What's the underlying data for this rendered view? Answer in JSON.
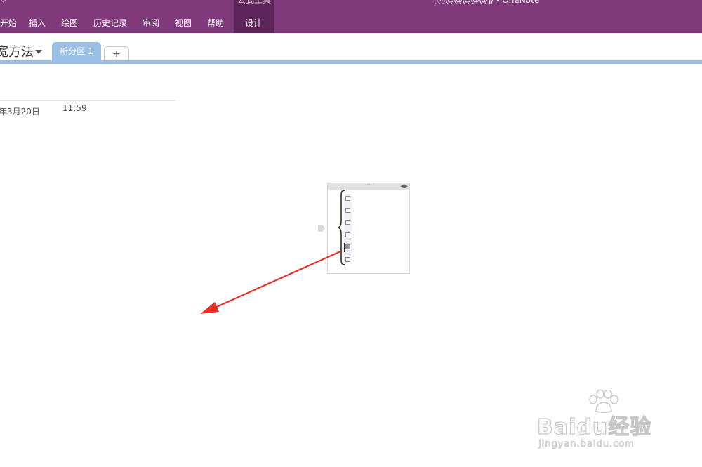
{
  "window": {
    "title": "[ⓐ@@@@@]/ - OneNote",
    "corner_glyph": "◇",
    "context_group_title": "公式工具"
  },
  "ribbon": {
    "tabs": [
      {
        "label": "开始"
      },
      {
        "label": "插入"
      },
      {
        "label": "绘图"
      },
      {
        "label": "历史记录"
      },
      {
        "label": "审阅"
      },
      {
        "label": "视图"
      },
      {
        "label": "帮助"
      },
      {
        "label": "设计",
        "active": true
      }
    ]
  },
  "notebook": {
    "name": "宽方法",
    "sections": [
      {
        "label": "新分区 1",
        "active": true
      }
    ],
    "add_section_label": "+"
  },
  "page": {
    "date": "年3月20日",
    "time": "11:59"
  },
  "note_container": {
    "handle_label": "····",
    "arrows_label": "◀▶",
    "placeholder_count": 6,
    "selected_index": 4
  },
  "annotation": {
    "arrow_color": "#e8302a"
  },
  "watermark": {
    "brand": "Baidu经验",
    "url": "jingyan.baidu.com"
  },
  "colors": {
    "ribbon": "#80397b",
    "context_tab": "#5c2458",
    "section_tab": "#9cc0e4"
  }
}
